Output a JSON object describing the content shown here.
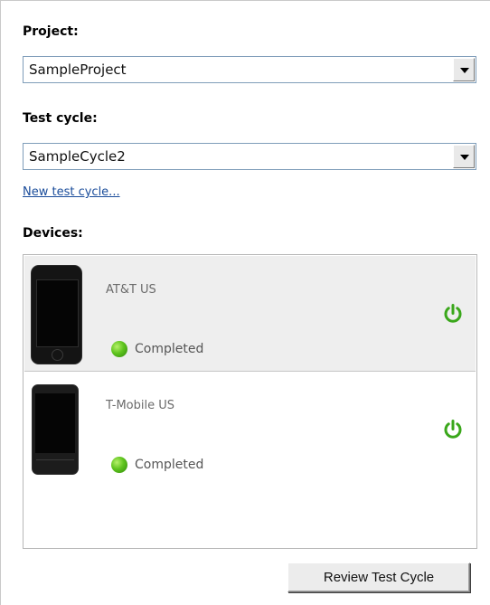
{
  "project": {
    "label": "Project:",
    "value": "SampleProject"
  },
  "test_cycle": {
    "label": "Test cycle:",
    "value": "SampleCycle2",
    "new_link": "New test cycle..."
  },
  "devices": {
    "label": "Devices:",
    "items": [
      {
        "name": "AT&T US",
        "status": "Completed",
        "status_color": "#4caf1a",
        "selected": true
      },
      {
        "name": "T-Mobile US",
        "status": "Completed",
        "status_color": "#4caf1a",
        "selected": false
      }
    ],
    "power_icon_color": "#3aa71b"
  },
  "actions": {
    "review_label": "Review Test Cycle"
  }
}
